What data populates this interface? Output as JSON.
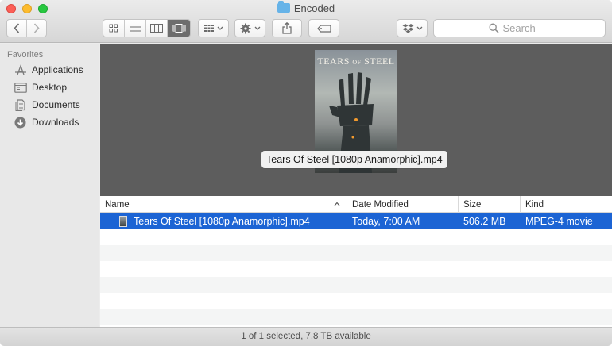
{
  "window": {
    "title": "Encoded"
  },
  "toolbar": {
    "back_icon": "chevron-left-icon",
    "forward_icon": "chevron-right-icon",
    "view_modes": [
      "icon-view",
      "list-view",
      "column-view",
      "cover-flow-view"
    ],
    "active_view": "cover-flow-view",
    "group_icon": "group-grid-icon",
    "action_icon": "gear-icon",
    "share_icon": "share-icon",
    "tag_icon": "tag-icon",
    "dropbox_icon": "dropbox-icon",
    "search_placeholder": "Search"
  },
  "sidebar": {
    "heading": "Favorites",
    "items": [
      {
        "label": "Applications",
        "icon": "applications-icon"
      },
      {
        "label": "Desktop",
        "icon": "desktop-icon"
      },
      {
        "label": "Documents",
        "icon": "documents-icon"
      },
      {
        "label": "Downloads",
        "icon": "downloads-icon"
      }
    ]
  },
  "preview": {
    "poster_title_main": "TEARS",
    "poster_title_of": "OF",
    "poster_title_end": "STEEL",
    "label": "Tears Of Steel [1080p Anamorphic].mp4"
  },
  "columns": {
    "name": "Name",
    "date": "Date Modified",
    "size": "Size",
    "kind": "Kind"
  },
  "files": [
    {
      "name": "Tears Of Steel [1080p Anamorphic].mp4",
      "date": "Today, 7:00 AM",
      "size": "506.2 MB",
      "kind": "MPEG-4 movie",
      "selected": true
    }
  ],
  "status": {
    "text": "1 of 1 selected, 7.8 TB available"
  },
  "colors": {
    "selection": "#1c64d4",
    "preview_bg": "#5d5d5d"
  }
}
